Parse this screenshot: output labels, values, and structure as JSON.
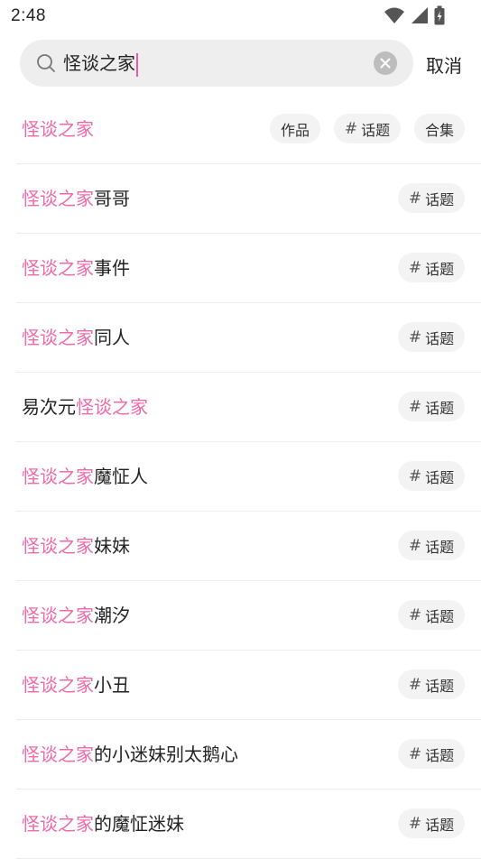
{
  "status_bar": {
    "time": "2:48",
    "icons": [
      "wifi-icon",
      "signal-icon",
      "battery-charging-icon"
    ]
  },
  "search": {
    "query": "怪谈之家",
    "cancel_label": "取消",
    "accent_color": "#f06aa9"
  },
  "results": [
    {
      "prefix": "",
      "highlight": "怪谈之家",
      "suffix": "",
      "chips": [
        "作品",
        "话题",
        "合集"
      ]
    },
    {
      "prefix": "",
      "highlight": "怪谈之家",
      "suffix": "哥哥",
      "chips": [
        "话题"
      ]
    },
    {
      "prefix": "",
      "highlight": "怪谈之家",
      "suffix": "事件",
      "chips": [
        "话题"
      ]
    },
    {
      "prefix": "",
      "highlight": "怪谈之家",
      "suffix": "同人",
      "chips": [
        "话题"
      ]
    },
    {
      "prefix": "易次元",
      "highlight": "怪谈之家",
      "suffix": "",
      "chips": [
        "话题"
      ]
    },
    {
      "prefix": "",
      "highlight": "怪谈之家",
      "suffix": "魔怔人",
      "chips": [
        "话题"
      ]
    },
    {
      "prefix": "",
      "highlight": "怪谈之家",
      "suffix": "妹妹",
      "chips": [
        "话题"
      ]
    },
    {
      "prefix": "",
      "highlight": "怪谈之家",
      "suffix": "潮汐",
      "chips": [
        "话题"
      ]
    },
    {
      "prefix": "",
      "highlight": "怪谈之家",
      "suffix": "小丑",
      "chips": [
        "话题"
      ]
    },
    {
      "prefix": "",
      "highlight": "怪谈之家",
      "suffix": "的小迷妹别太鹅心",
      "chips": [
        "话题"
      ]
    },
    {
      "prefix": "",
      "highlight": "怪谈之家",
      "suffix": "的魔怔迷妹",
      "chips": [
        "话题"
      ]
    }
  ]
}
